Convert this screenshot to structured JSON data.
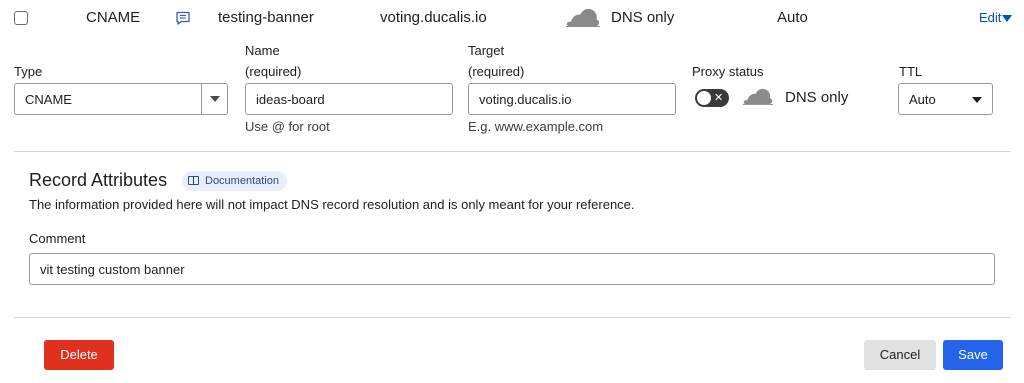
{
  "record": {
    "type": "CNAME",
    "name": "testing-banner",
    "content": "voting.ducalis.io",
    "proxy_status": "DNS only",
    "ttl": "Auto",
    "edit_label": "Edit"
  },
  "form": {
    "type_label": "Type",
    "type_value": "CNAME",
    "name_label": "Name",
    "name_required": "(required)",
    "name_value": "ideas-board",
    "name_hint": "Use @ for root",
    "target_label": "Target",
    "target_required": "(required)",
    "target_value": "voting.ducalis.io",
    "target_hint": "E.g. www.example.com",
    "proxy_label": "Proxy status",
    "proxy_value": "DNS only",
    "toggle_symbol": "✕",
    "ttl_label": "TTL",
    "ttl_value": "Auto"
  },
  "attributes": {
    "title": "Record Attributes",
    "doc_label": "Documentation",
    "description": "The information provided here will not impact DNS record resolution and is only meant for your reference.",
    "comment_label": "Comment",
    "comment_value": "vit testing custom banner"
  },
  "buttons": {
    "delete": "Delete",
    "cancel": "Cancel",
    "save": "Save"
  },
  "colors": {
    "link": "#0051c3",
    "delete": "#e0301e",
    "save": "#2563eb",
    "cancel": "#e1e1e1",
    "badge_bg": "#e9eefb"
  }
}
